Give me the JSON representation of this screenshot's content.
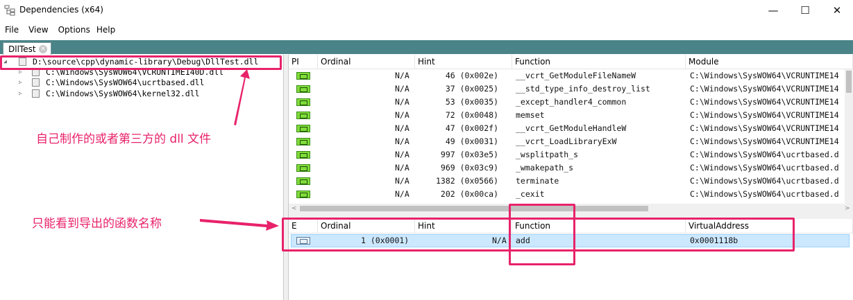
{
  "window": {
    "title": "Dependencies (x64)",
    "minimize": "—",
    "maximize": "☐",
    "close": "✕"
  },
  "menu": [
    "File",
    "View",
    "Options",
    "Help"
  ],
  "tab": {
    "label": "DllTest",
    "close": "✕"
  },
  "tree": [
    {
      "text": "D:\\source\\cpp\\dynamic-library\\Debug\\DllTest.dll",
      "toggle": "◢"
    },
    {
      "text": "C:\\Windows\\SysWOW64\\VCRUNTIME140D.dll",
      "toggle": "▷"
    },
    {
      "text": "C:\\Windows\\SysWOW64\\ucrtbased.dll",
      "toggle": "▷"
    },
    {
      "text": "C:\\Windows\\SysWOW64\\kernel32.dll",
      "toggle": "▷"
    }
  ],
  "imports": {
    "headers": {
      "pi": "PI",
      "ordinal": "Ordinal",
      "hint": "Hint",
      "function": "Function",
      "module": "Module"
    },
    "rows": [
      {
        "ordinal": "N/A",
        "hint": "46 (0x002e)",
        "function": "__vcrt_GetModuleFileNameW",
        "module": "C:\\Windows\\SysWOW64\\VCRUNTIME14"
      },
      {
        "ordinal": "N/A",
        "hint": "37 (0x0025)",
        "function": "__std_type_info_destroy_list",
        "module": "C:\\Windows\\SysWOW64\\VCRUNTIME14"
      },
      {
        "ordinal": "N/A",
        "hint": "53 (0x0035)",
        "function": "_except_handler4_common",
        "module": "C:\\Windows\\SysWOW64\\VCRUNTIME14"
      },
      {
        "ordinal": "N/A",
        "hint": "72 (0x0048)",
        "function": "memset",
        "module": "C:\\Windows\\SysWOW64\\VCRUNTIME14"
      },
      {
        "ordinal": "N/A",
        "hint": "47 (0x002f)",
        "function": "__vcrt_GetModuleHandleW",
        "module": "C:\\Windows\\SysWOW64\\VCRUNTIME14"
      },
      {
        "ordinal": "N/A",
        "hint": "49 (0x0031)",
        "function": "__vcrt_LoadLibraryExW",
        "module": "C:\\Windows\\SysWOW64\\VCRUNTIME14"
      },
      {
        "ordinal": "N/A",
        "hint": "997 (0x03e5)",
        "function": "_wsplitpath_s",
        "module": "C:\\Windows\\SysWOW64\\ucrtbased.d"
      },
      {
        "ordinal": "N/A",
        "hint": "969 (0x03c9)",
        "function": "_wmakepath_s",
        "module": "C:\\Windows\\SysWOW64\\ucrtbased.d"
      },
      {
        "ordinal": "N/A",
        "hint": "1382 (0x0566)",
        "function": "terminate",
        "module": "C:\\Windows\\SysWOW64\\ucrtbased.d"
      },
      {
        "ordinal": "N/A",
        "hint": "202 (0x00ca)",
        "function": "_cexit",
        "module": "C:\\Windows\\SysWOW64\\ucrtbased.d"
      }
    ]
  },
  "exports": {
    "headers": {
      "e": "E",
      "ordinal": "Ordinal",
      "hint": "Hint",
      "function": "Function",
      "address": "VirtualAddress"
    },
    "rows": [
      {
        "ordinal": "1 (0x0001)",
        "hint": "N/A",
        "function": "add",
        "address": "0x0001118b"
      }
    ]
  },
  "annotations": {
    "dll_note": "自己制作的或者第三方的 dll 文件",
    "export_note": "只能看到导出的函数名称"
  },
  "colors": {
    "accent": "#e8226a",
    "tabstrip": "#4a8388",
    "selection": "#cce8ff"
  },
  "icons": {
    "app": "dependencies-app-icon",
    "import": "c-function-icon",
    "export": "export-function-icon",
    "module": "dll-module-icon"
  }
}
